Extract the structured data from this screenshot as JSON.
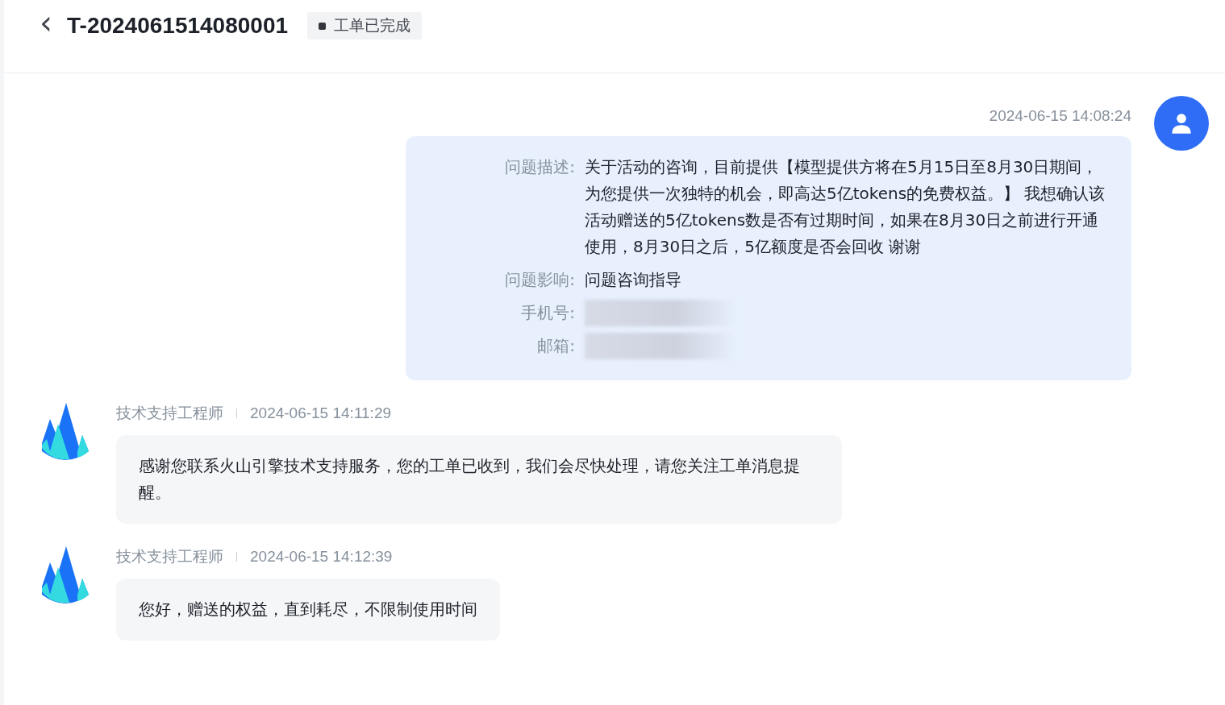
{
  "header": {
    "back": "‹",
    "ticket_id": "T-2024061514080001",
    "status": {
      "label": "工单已完成",
      "kind": "done"
    }
  },
  "messages": [
    {
      "kind": "user",
      "time": "2024-06-15 14:08:24",
      "fields": [
        {
          "label": "问题描述:",
          "kind": "text",
          "value": "关于活动的咨询，目前提供【模型提供方将在5月15日至8月30日期间，为您提供一次独特的机会，即高达5亿tokens的免费权益。】 我想确认该活动赠送的5亿tokens数是否有过期时间，如果在8月30日之前进行开通使用，8月30日之后，5亿额度是否会回收 谢谢"
        },
        {
          "label": "问题影响:",
          "kind": "text",
          "value": "问题咨询指导"
        },
        {
          "label": "手机号:",
          "kind": "redacted"
        },
        {
          "label": "邮箱:",
          "kind": "redacted"
        }
      ]
    },
    {
      "kind": "agent",
      "sender": "技术支持工程师",
      "time": "2024-06-15 14:11:29",
      "text": "感谢您联系火山引擎技术支持服务，您的工单已收到，我们会尽快处理，请您关注工单消息提醒。"
    },
    {
      "kind": "agent",
      "sender": "技术支持工程师",
      "time": "2024-06-15 14:12:39",
      "text": "您好，赠送的权益，直到耗尽，不限制使用时间"
    }
  ]
}
